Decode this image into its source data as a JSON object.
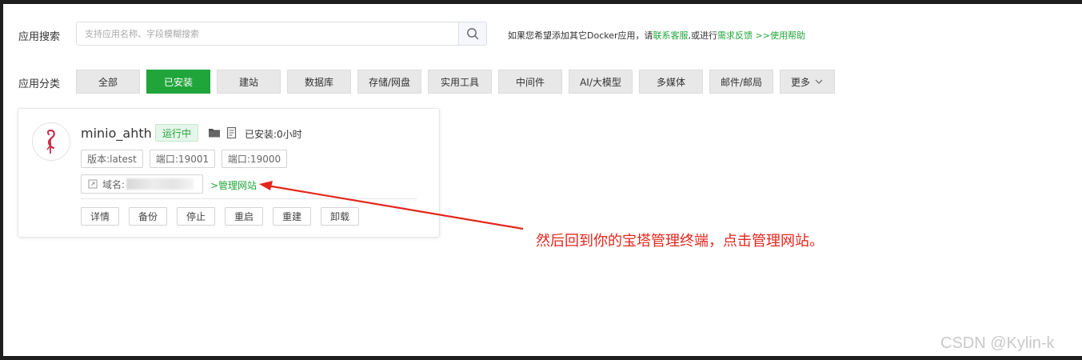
{
  "search": {
    "label": "应用搜索",
    "placeholder": "支持应用名称、字段模糊搜索",
    "icon": "search-icon"
  },
  "help": {
    "prefix": "如果您希望添加其它Docker应用，请",
    "contact_link": "联系客服",
    "middle": ",或进行",
    "feedback_link": "需求反馈",
    "help_link": " >>使用帮助"
  },
  "categories": {
    "label": "应用分类",
    "items": [
      "全部",
      "已安装",
      "建站",
      "数据库",
      "存储/网盘",
      "实用工具",
      "中间件",
      "AI/大模型",
      "多媒体",
      "邮件/邮局",
      "更多"
    ],
    "active": "已安装"
  },
  "app": {
    "name": "minio_ahth",
    "status": "运行中",
    "installed_time": "已安装:0小时",
    "version_tag": "版本:latest",
    "port_tag_1": "端口:19001",
    "port_tag_2": "端口:19000",
    "domain_label": "域名:",
    "manage_link": ">管理网站",
    "actions": [
      "详情",
      "备份",
      "停止",
      "重启",
      "重建",
      "卸载"
    ]
  },
  "annotation": {
    "text": "然后回到你的宝塔管理终端，点击管理网站。",
    "color": "#e4261c"
  },
  "watermark": "CSDN @Kylin-k",
  "colors": {
    "accent": "#20a53a",
    "annotation": "#e4261c"
  }
}
